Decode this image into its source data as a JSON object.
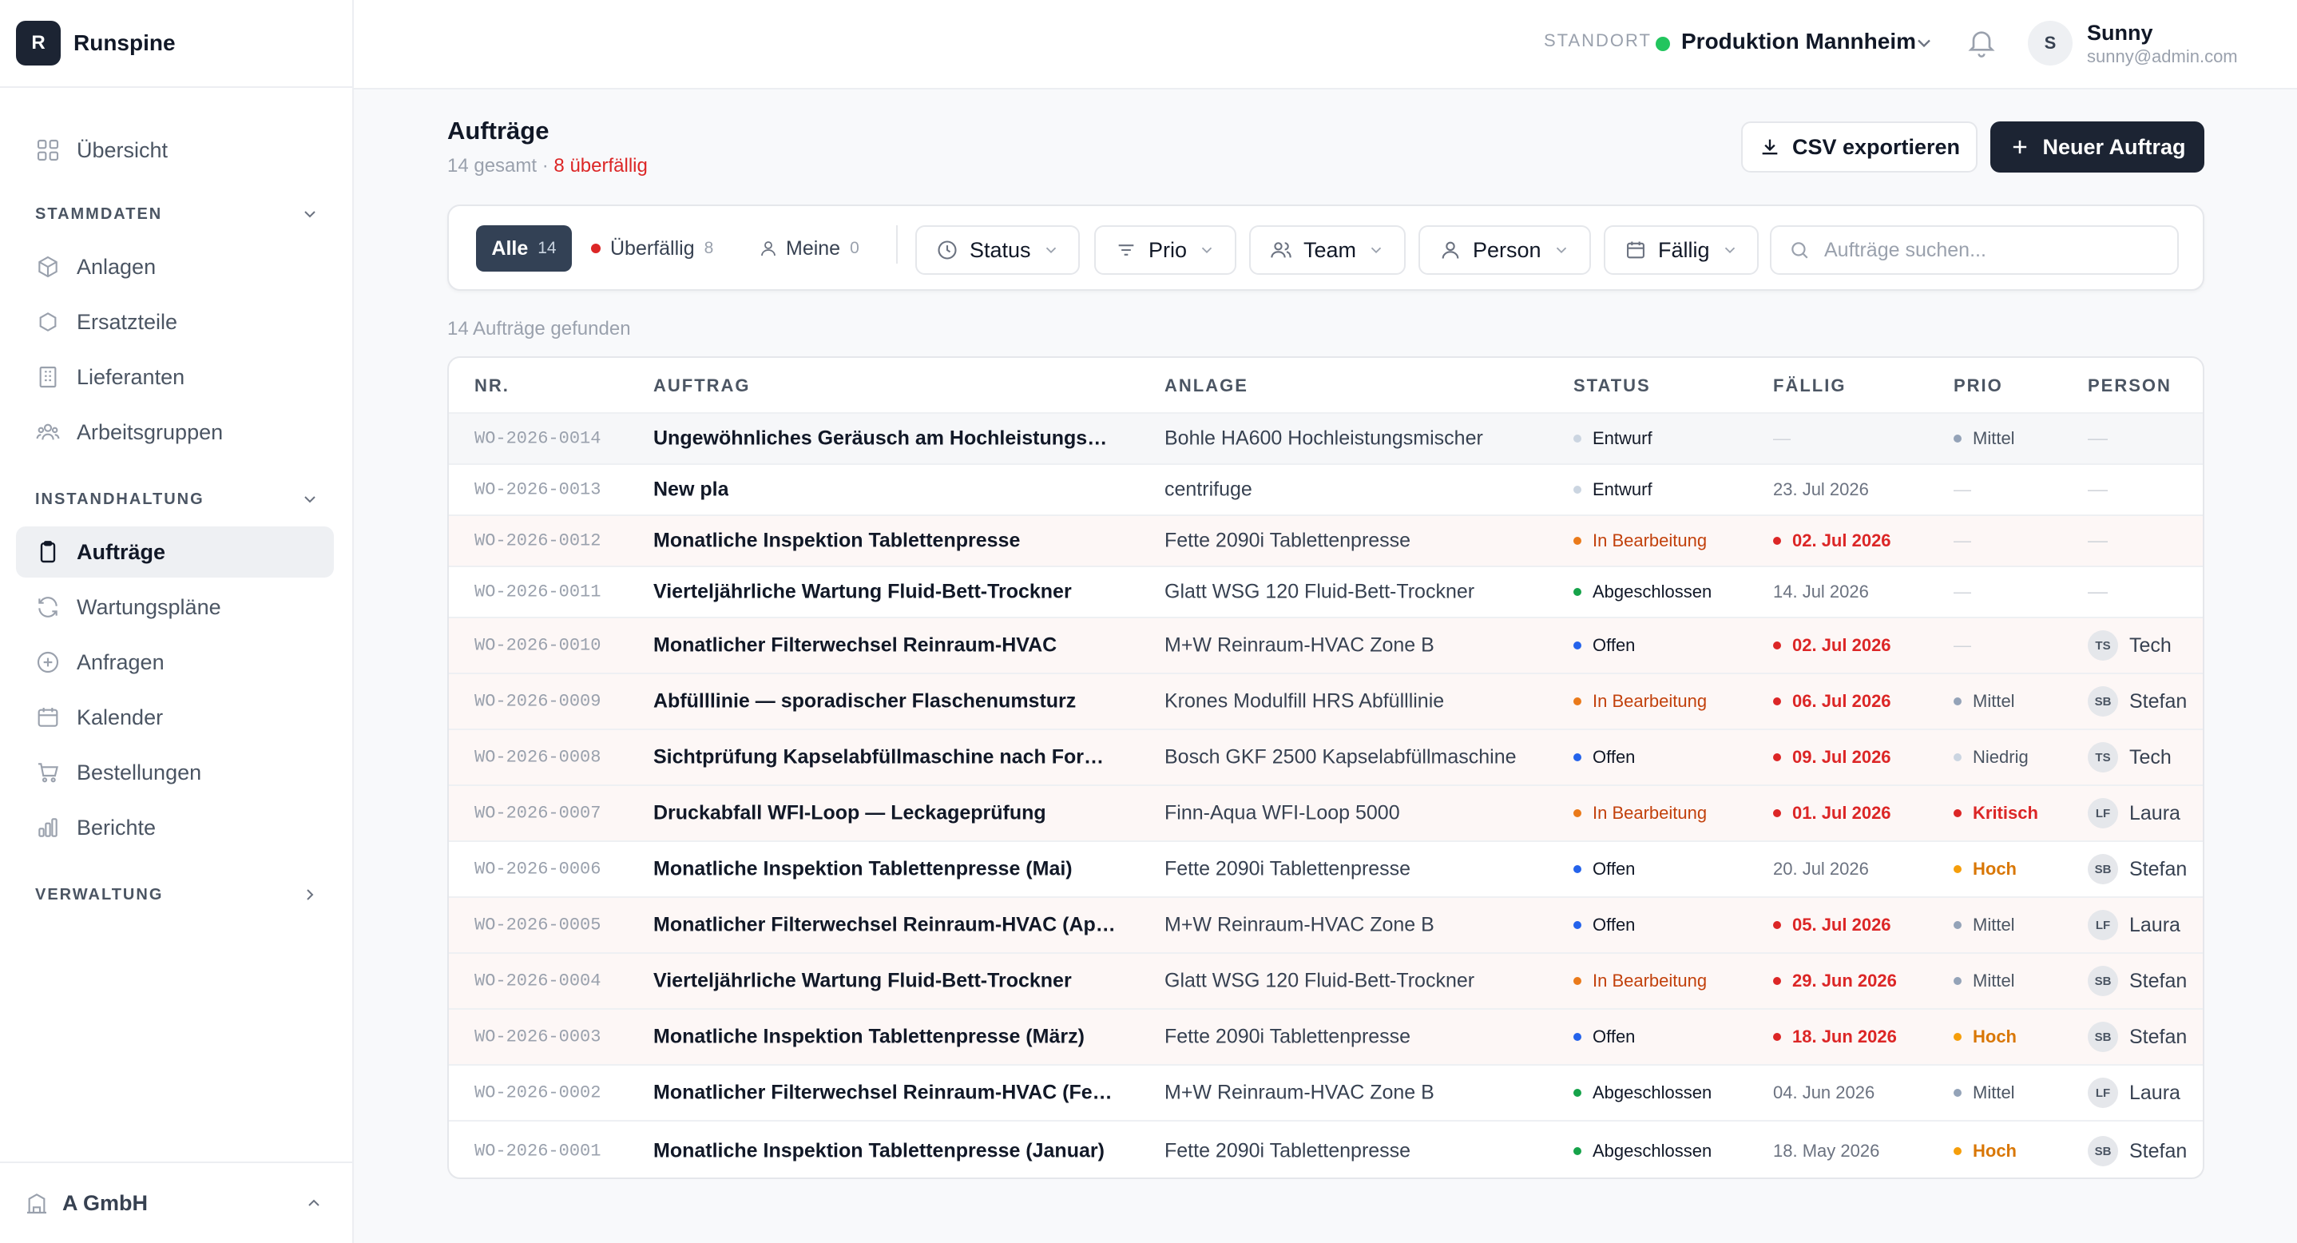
{
  "brand": {
    "logo_letter": "R",
    "name": "Runspine"
  },
  "sidebar": {
    "overview": "Übersicht",
    "sections": {
      "stammdaten": "STAMMDATEN",
      "instandhaltung": "INSTANDHALTUNG",
      "verwaltung": "VERWALTUNG"
    },
    "items": {
      "anlagen": "Anlagen",
      "ersatzteile": "Ersatzteile",
      "lieferanten": "Lieferanten",
      "arbeitsgruppen": "Arbeitsgruppen",
      "auftraege": "Aufträge",
      "wartungsplaene": "Wartungspläne",
      "anfragen": "Anfragen",
      "kalender": "Kalender",
      "bestellungen": "Bestellungen",
      "berichte": "Berichte"
    },
    "active_item": "auftraege",
    "org": "A GmbH"
  },
  "topbar": {
    "site_label": "STANDORT",
    "site_name": "Produktion Mannheim",
    "site_status_color": "#22c55e",
    "user_initial": "S",
    "user_name": "Sunny",
    "user_email": "sunny@admin.com"
  },
  "page": {
    "title": "Aufträge",
    "total": "14 gesamt",
    "separator": "·",
    "overdue": "8 überfällig",
    "export_label": "CSV exportieren",
    "new_label": "Neuer Auftrag"
  },
  "filters": {
    "all_label": "Alle",
    "all_count": "14",
    "overdue_label": "Überfällig",
    "overdue_count": "8",
    "mine_label": "Meine",
    "mine_count": "0",
    "status": "Status",
    "prio": "Prio",
    "team": "Team",
    "person": "Person",
    "due": "Fällig",
    "search_placeholder": "Aufträge suchen..."
  },
  "result_count": "14 Aufträge gefunden",
  "table": {
    "columns": [
      "NR.",
      "AUFTRAG",
      "ANLAGE",
      "STATUS",
      "FÄLLIG",
      "PRIO",
      "PERSON"
    ],
    "rows": [
      {
        "nr": "WO-2026-0014",
        "title": "Ungewöhnliches Geräusch am Hochleistungsmi...",
        "asset": "Bohle HA600 Hochleistungsmischer",
        "status": "Entwurf",
        "due": "—",
        "due_overdue": false,
        "prio": "Mittel",
        "initials": "",
        "person": "—"
      },
      {
        "nr": "WO-2026-0013",
        "title": "New pla",
        "asset": "centrifuge",
        "status": "Entwurf",
        "due": "23. Jul 2026",
        "due_overdue": false,
        "prio": "—",
        "initials": "",
        "person": "—"
      },
      {
        "nr": "WO-2026-0012",
        "title": "Monatliche Inspektion Tablettenpresse",
        "asset": "Fette 2090i Tablettenpresse",
        "status": "In Bearbeitung",
        "due": "02. Jul 2026",
        "due_overdue": true,
        "prio": "—",
        "initials": "",
        "person": "—"
      },
      {
        "nr": "WO-2026-0011",
        "title": "Vierteljährliche Wartung Fluid-Bett-Trockner",
        "asset": "Glatt WSG 120 Fluid-Bett-Trockner",
        "status": "Abgeschlossen",
        "due": "14. Jul 2026",
        "due_overdue": false,
        "prio": "—",
        "initials": "",
        "person": "—"
      },
      {
        "nr": "WO-2026-0010",
        "title": "Monatlicher Filterwechsel Reinraum-HVAC",
        "asset": "M+W Reinraum-HVAC Zone B",
        "status": "Offen",
        "due": "02. Jul 2026",
        "due_overdue": true,
        "prio": "—",
        "initials": "TS",
        "person": "Tech"
      },
      {
        "nr": "WO-2026-0009",
        "title": "Abfülllinie — sporadischer Flaschenumsturz",
        "asset": "Krones Modulfill HRS Abfülllinie",
        "status": "In Bearbeitung",
        "due": "06. Jul 2026",
        "due_overdue": true,
        "prio": "Mittel",
        "initials": "SB",
        "person": "Stefan"
      },
      {
        "nr": "WO-2026-0008",
        "title": "Sichtprüfung Kapselabfüllmaschine nach Forma...",
        "asset": "Bosch GKF 2500 Kapselabfüllmaschine",
        "status": "Offen",
        "due": "09. Jul 2026",
        "due_overdue": true,
        "prio": "Niedrig",
        "initials": "TS",
        "person": "Tech"
      },
      {
        "nr": "WO-2026-0007",
        "title": "Druckabfall WFI-Loop — Leckageprüfung",
        "asset": "Finn-Aqua WFI-Loop 5000",
        "status": "In Bearbeitung",
        "due": "01. Jul 2026",
        "due_overdue": true,
        "prio": "Kritisch",
        "initials": "LF",
        "person": "Laura"
      },
      {
        "nr": "WO-2026-0006",
        "title": "Monatliche Inspektion Tablettenpresse (Mai)",
        "asset": "Fette 2090i Tablettenpresse",
        "status": "Offen",
        "due": "20. Jul 2026",
        "due_overdue": false,
        "prio": "Hoch",
        "initials": "SB",
        "person": "Stefan"
      },
      {
        "nr": "WO-2026-0005",
        "title": "Monatlicher Filterwechsel Reinraum-HVAC (April)",
        "asset": "M+W Reinraum-HVAC Zone B",
        "status": "Offen",
        "due": "05. Jul 2026",
        "due_overdue": true,
        "prio": "Mittel",
        "initials": "LF",
        "person": "Laura"
      },
      {
        "nr": "WO-2026-0004",
        "title": "Vierteljährliche Wartung Fluid-Bett-Trockner",
        "asset": "Glatt WSG 120 Fluid-Bett-Trockner",
        "status": "In Bearbeitung",
        "due": "29. Jun 2026",
        "due_overdue": true,
        "prio": "Mittel",
        "initials": "SB",
        "person": "Stefan"
      },
      {
        "nr": "WO-2026-0003",
        "title": "Monatliche Inspektion Tablettenpresse (März)",
        "asset": "Fette 2090i Tablettenpresse",
        "status": "Offen",
        "due": "18. Jun 2026",
        "due_overdue": true,
        "prio": "Hoch",
        "initials": "SB",
        "person": "Stefan"
      },
      {
        "nr": "WO-2026-0002",
        "title": "Monatlicher Filterwechsel Reinraum-HVAC (Feb...",
        "asset": "M+W Reinraum-HVAC Zone B",
        "status": "Abgeschlossen",
        "due": "04. Jun 2026",
        "due_overdue": false,
        "prio": "Mittel",
        "initials": "LF",
        "person": "Laura"
      },
      {
        "nr": "WO-2026-0001",
        "title": "Monatliche Inspektion Tablettenpresse (Januar)",
        "asset": "Fette 2090i Tablettenpresse",
        "status": "Abgeschlossen",
        "due": "18. May 2026",
        "due_overdue": false,
        "prio": "Hoch",
        "initials": "SB",
        "person": "Stefan"
      }
    ]
  },
  "colors": {
    "status": {
      "Entwurf": "#cbd5e1",
      "In Bearbeitung": "#ea7a1a",
      "Abgeschlossen": "#16a34a",
      "Offen": "#2563eb"
    },
    "status_text": {
      "Entwurf": "#111827",
      "In Bearbeitung": "#c2410c",
      "Abgeschlossen": "#111827",
      "Offen": "#111827"
    },
    "prio": {
      "Mittel": "#94a3b8",
      "Niedrig": "#cbd5e1",
      "Hoch": "#f59e0b",
      "Kritisch": "#dc2626"
    },
    "prio_text": {
      "Mittel": "#4b5563",
      "Niedrig": "#4b5563",
      "Hoch": "#d97706",
      "Kritisch": "#dc2626"
    },
    "overdue": "#dc2626",
    "primary": "#1c2433"
  }
}
